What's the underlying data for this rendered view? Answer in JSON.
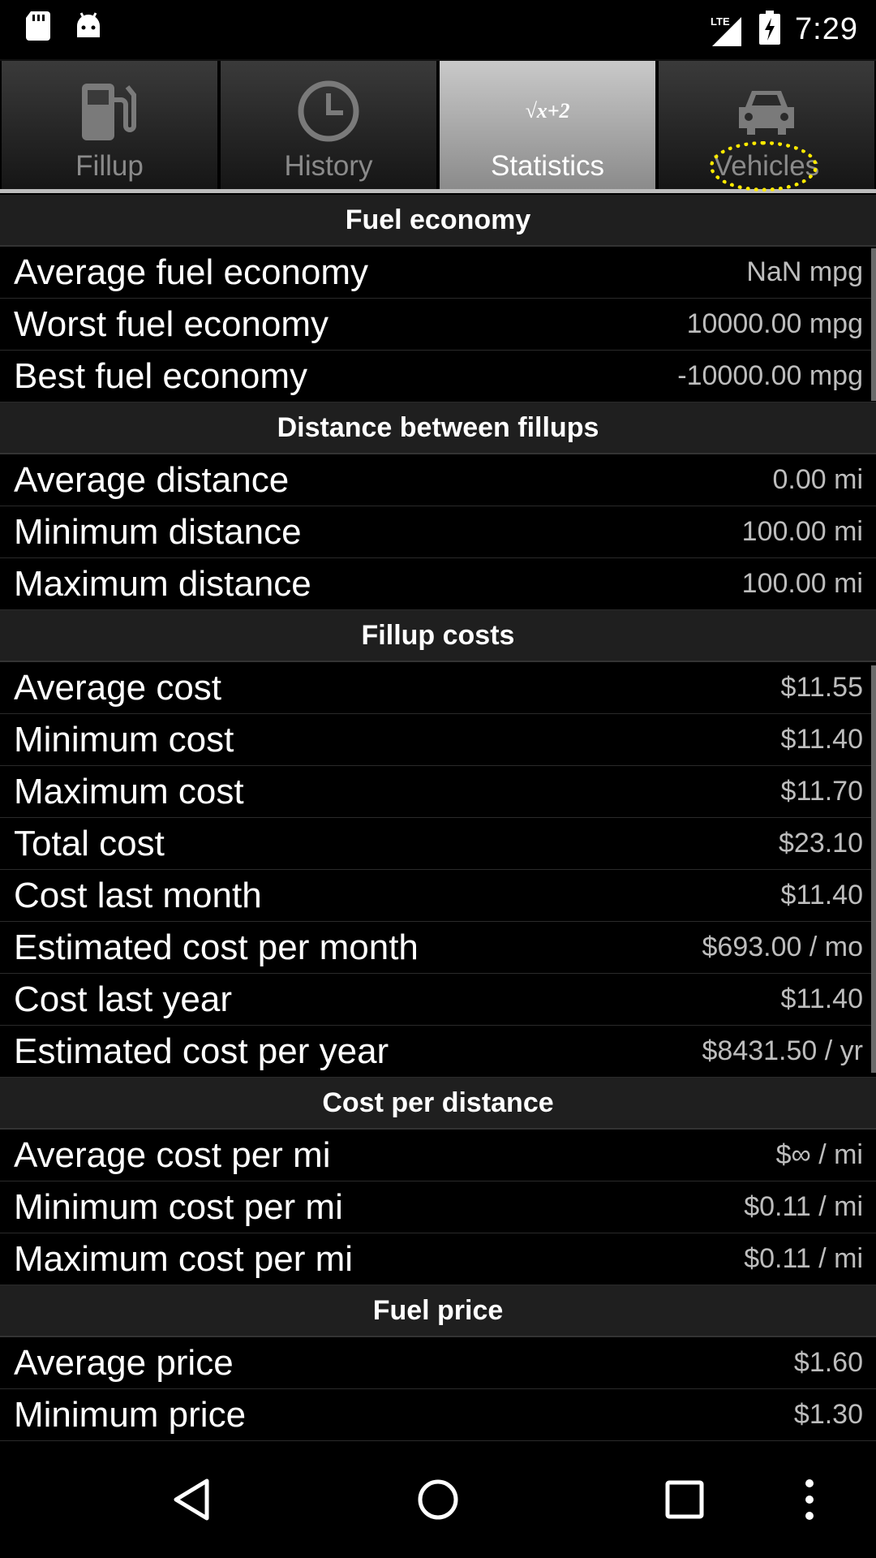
{
  "status_bar": {
    "time": "7:29",
    "network": "LTE",
    "icons": [
      "sd-card-icon",
      "android-debug-icon",
      "signal-icon",
      "battery-charging-icon"
    ]
  },
  "tabs": [
    {
      "label": "Fillup",
      "icon": "fuel-pump-icon",
      "active": false
    },
    {
      "label": "History",
      "icon": "clock-icon",
      "active": false
    },
    {
      "label": "Statistics",
      "icon": "sqrt-formula-icon",
      "icon_text": "√x+2",
      "active": true
    },
    {
      "label": "Vehicles",
      "icon": "car-icon",
      "active": false
    }
  ],
  "sections": [
    {
      "title": "Fuel economy",
      "rows": [
        {
          "label": "Average fuel economy",
          "value": "NaN mpg"
        },
        {
          "label": "Worst fuel economy",
          "value": "10000.00 mpg"
        },
        {
          "label": "Best fuel economy",
          "value": "-10000.00 mpg"
        }
      ]
    },
    {
      "title": "Distance between fillups",
      "rows": [
        {
          "label": "Average distance",
          "value": "0.00 mi"
        },
        {
          "label": "Minimum distance",
          "value": "100.00 mi"
        },
        {
          "label": "Maximum distance",
          "value": "100.00 mi"
        }
      ]
    },
    {
      "title": "Fillup costs",
      "rows": [
        {
          "label": "Average cost",
          "value": "$11.55"
        },
        {
          "label": "Minimum cost",
          "value": "$11.40"
        },
        {
          "label": "Maximum cost",
          "value": "$11.70"
        },
        {
          "label": "Total cost",
          "value": "$23.10"
        },
        {
          "label": "Cost last month",
          "value": "$11.40"
        },
        {
          "label": "Estimated cost per month",
          "value": "$693.00 / mo"
        },
        {
          "label": "Cost last year",
          "value": "$11.40"
        },
        {
          "label": "Estimated cost per year",
          "value": "$8431.50 / yr"
        }
      ]
    },
    {
      "title": "Cost per distance",
      "rows": [
        {
          "label": "Average cost per mi",
          "value": "$∞ / mi"
        },
        {
          "label": "Minimum cost per mi",
          "value": "$0.11 / mi"
        },
        {
          "label": "Maximum cost per mi",
          "value": "$0.11 / mi"
        }
      ]
    },
    {
      "title": "Fuel price",
      "rows": [
        {
          "label": "Average price",
          "value": "$1.60"
        },
        {
          "label": "Minimum price",
          "value": "$1.30"
        }
      ]
    }
  ],
  "nav_bar": [
    "back-icon",
    "home-icon",
    "recents-icon",
    "overflow-menu-icon"
  ],
  "colors": {
    "highlight": "#ffea00",
    "active_tab": "#b0b0b0",
    "section_bg": "#1f1f1f"
  }
}
